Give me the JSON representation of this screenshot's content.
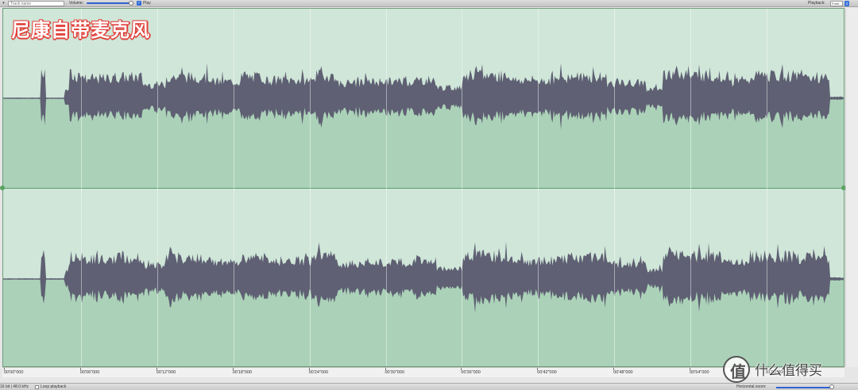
{
  "toolbar": {
    "menu_icon": "chevron-down-icon",
    "track_name_placeholder": "Track name",
    "volume_label": "Volume:",
    "play_label": "Play",
    "play_checked": true,
    "playback_label": "Playback:",
    "playback_value": "Front"
  },
  "overlay": {
    "label": "尼康自带麦克风"
  },
  "waveform": {
    "accent_color": "#5f6073",
    "upper_bg": "#cfe6d8",
    "lower_bg": "#abd2b8"
  },
  "ruler": {
    "ticks": [
      "00'00\"000",
      "00'06\"000",
      "00'12\"000",
      "00'18\"000",
      "00'24\"000",
      "00'30\"000",
      "00'36\"000",
      "00'42\"000",
      "00'48\"000",
      "00'54\"000",
      "01'00\"000"
    ]
  },
  "statusbar": {
    "format": "16 bit | 48.0 kHz",
    "loop_label": "Loop playback",
    "zoom_label": "Horizontal zoom:"
  },
  "watermark": {
    "logo": "值",
    "text": "什么值得买"
  }
}
